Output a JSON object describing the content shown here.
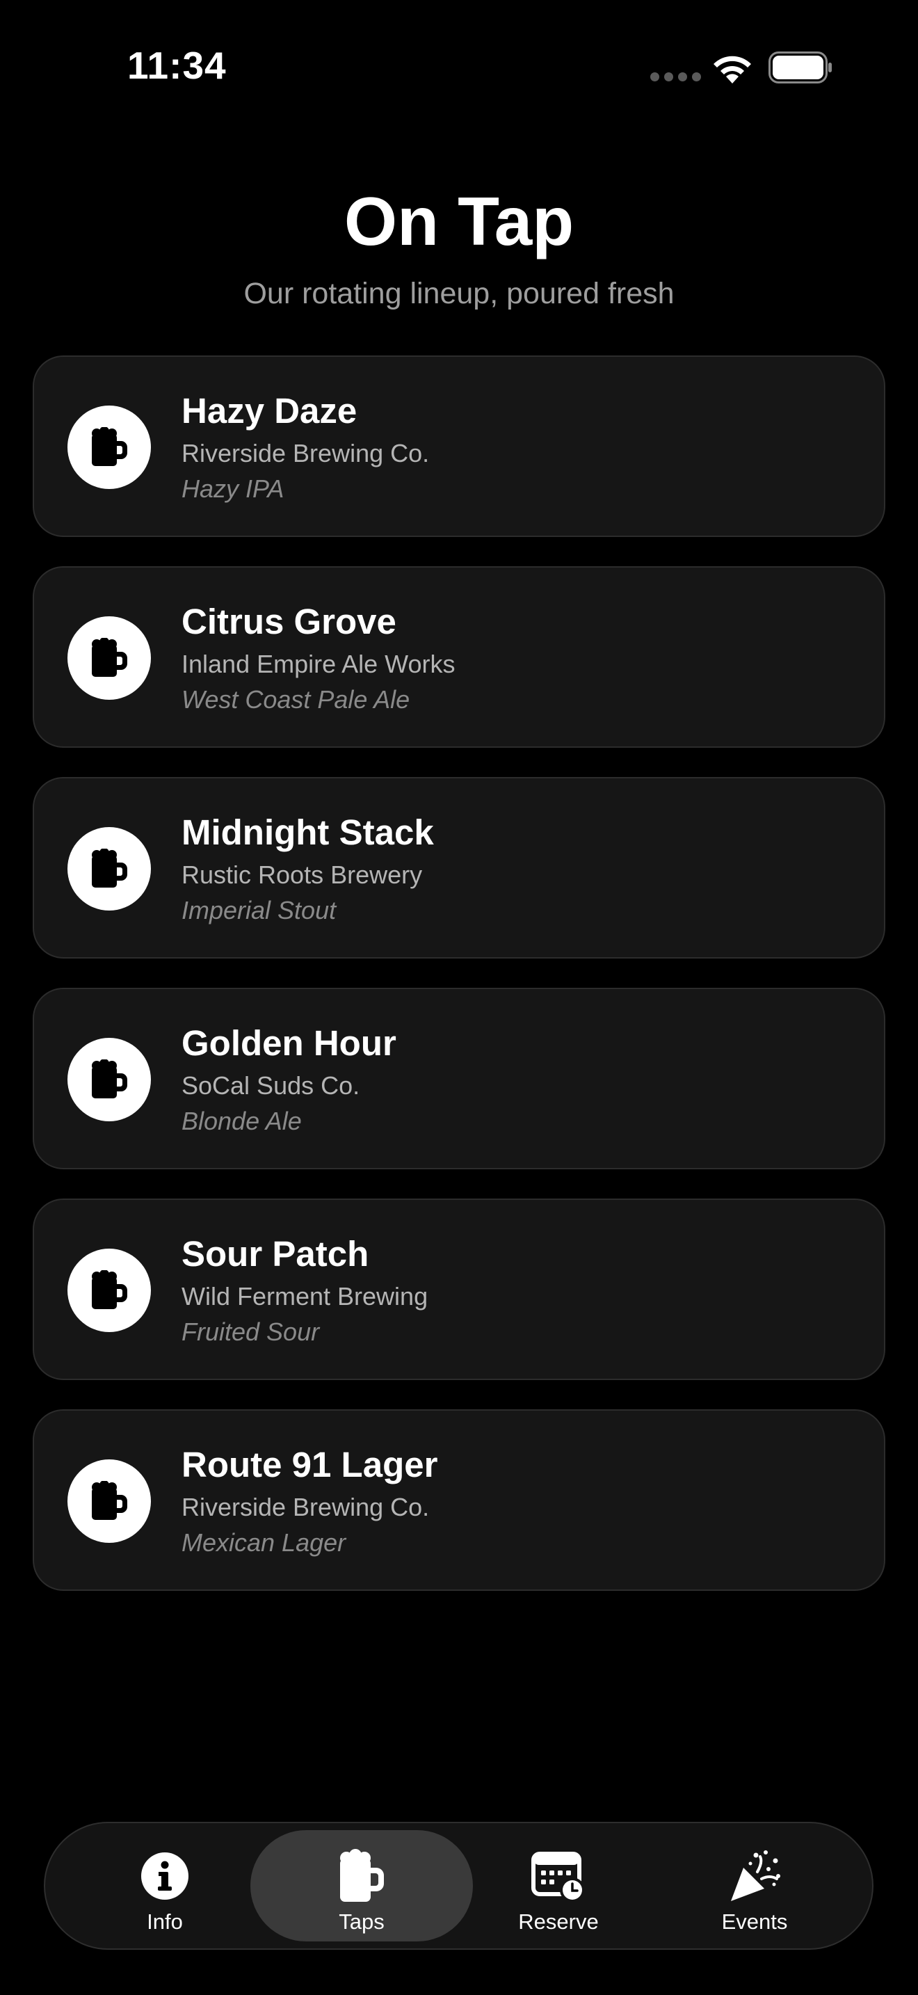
{
  "status_bar": {
    "time": "11:34"
  },
  "header": {
    "title": "On Tap",
    "subtitle": "Our rotating lineup, poured fresh"
  },
  "taps": [
    {
      "name": "Hazy Daze",
      "brewery": "Riverside Brewing Co.",
      "style": "Hazy IPA",
      "icon": "beer-mug-icon"
    },
    {
      "name": "Citrus Grove",
      "brewery": "Inland Empire Ale Works",
      "style": "West Coast Pale Ale",
      "icon": "beer-mug-icon"
    },
    {
      "name": "Midnight Stack",
      "brewery": "Rustic Roots Brewery",
      "style": "Imperial Stout",
      "icon": "beer-mug-icon"
    },
    {
      "name": "Golden Hour",
      "brewery": "SoCal Suds Co.",
      "style": "Blonde Ale",
      "icon": "beer-mug-icon"
    },
    {
      "name": "Sour Patch",
      "brewery": "Wild Ferment Brewing",
      "style": "Fruited Sour",
      "icon": "beer-mug-icon"
    },
    {
      "name": "Route 91 Lager",
      "brewery": "Riverside Brewing Co.",
      "style": "Mexican Lager",
      "icon": "beer-mug-icon"
    }
  ],
  "tab_bar": {
    "active": "taps",
    "items": [
      {
        "id": "info",
        "label": "Info",
        "icon": "info-icon"
      },
      {
        "id": "taps",
        "label": "Taps",
        "icon": "beer-mug-icon"
      },
      {
        "id": "reserve",
        "label": "Reserve",
        "icon": "calendar-clock-icon"
      },
      {
        "id": "events",
        "label": "Events",
        "icon": "party-popper-icon"
      }
    ]
  },
  "colors": {
    "background": "#000000",
    "card": "#161616",
    "card_border": "#2c2c2c",
    "active_tab": "#3a3a3a",
    "secondary_text": "#b5b5b5",
    "tertiary_text": "#8a8a8a"
  }
}
